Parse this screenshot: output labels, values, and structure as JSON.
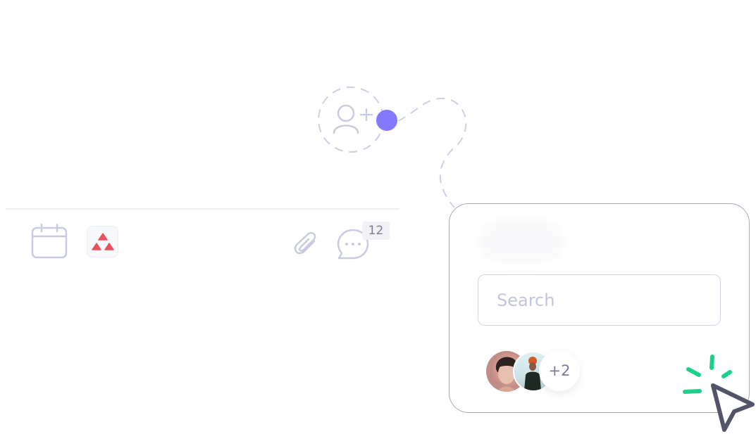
{
  "toolbar": {
    "icons": [
      {
        "name": "calendar-icon"
      },
      {
        "name": "app-logo-icon"
      },
      {
        "name": "paperclip-icon"
      },
      {
        "name": "comment-icon"
      }
    ],
    "comment_count": "12"
  },
  "add_user": {
    "icon": "user-plus-icon",
    "connector_color": "#8478fb"
  },
  "invite_card": {
    "search": {
      "value": "",
      "placeholder": "Search"
    },
    "avatars": [
      {
        "name": "member-avatar-1"
      },
      {
        "name": "member-avatar-2"
      }
    ],
    "more_count": "+2"
  },
  "cursor": {
    "icon": "cursor-click-icon",
    "burst_color": "#1ecf8c",
    "pointer_color": "#535468"
  },
  "colors": {
    "accent": "#8478fb",
    "brand_red": "#e8505b",
    "muted_icon": "#c9cbe0"
  }
}
